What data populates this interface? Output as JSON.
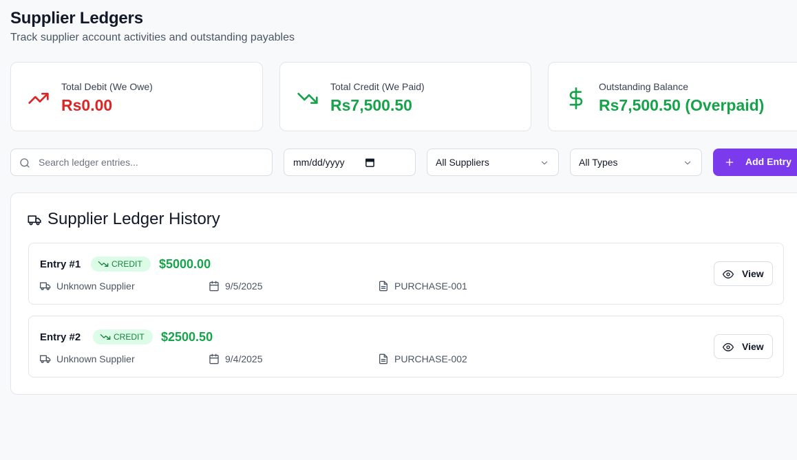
{
  "header": {
    "title": "Supplier Ledgers",
    "subtitle": "Track supplier account activities and outstanding payables"
  },
  "stats": [
    {
      "label": "Total Debit (We Owe)",
      "value": "Rs0.00",
      "icon": "trending-up-icon",
      "color": "#dc2626"
    },
    {
      "label": "Total Credit (We Paid)",
      "value": "Rs7,500.50",
      "icon": "trending-down-icon",
      "color": "#16a34a"
    },
    {
      "label": "Outstanding Balance",
      "value": "Rs7,500.50 (Overpaid)",
      "icon": "dollar-icon",
      "color": "#16a34a"
    }
  ],
  "filters": {
    "search_placeholder": "Search ledger entries...",
    "date_placeholder": "mm/dd/yyyy",
    "supplier_selected": "All Suppliers",
    "type_selected": "All Types",
    "add_label": "Add Entry"
  },
  "history": {
    "title": "Supplier Ledger History",
    "entries": [
      {
        "title": "Entry #1",
        "badge": "CREDIT",
        "amount": "$5000.00",
        "supplier": "Unknown Supplier",
        "date": "9/5/2025",
        "reference": "PURCHASE-001",
        "view_label": "View"
      },
      {
        "title": "Entry #2",
        "badge": "CREDIT",
        "amount": "$2500.50",
        "supplier": "Unknown Supplier",
        "date": "9/4/2025",
        "reference": "PURCHASE-002",
        "view_label": "View"
      }
    ]
  },
  "colors": {
    "accent": "#7c3aed",
    "debit": "#dc2626",
    "credit": "#16a34a",
    "badge_bg": "#dcfce7"
  }
}
